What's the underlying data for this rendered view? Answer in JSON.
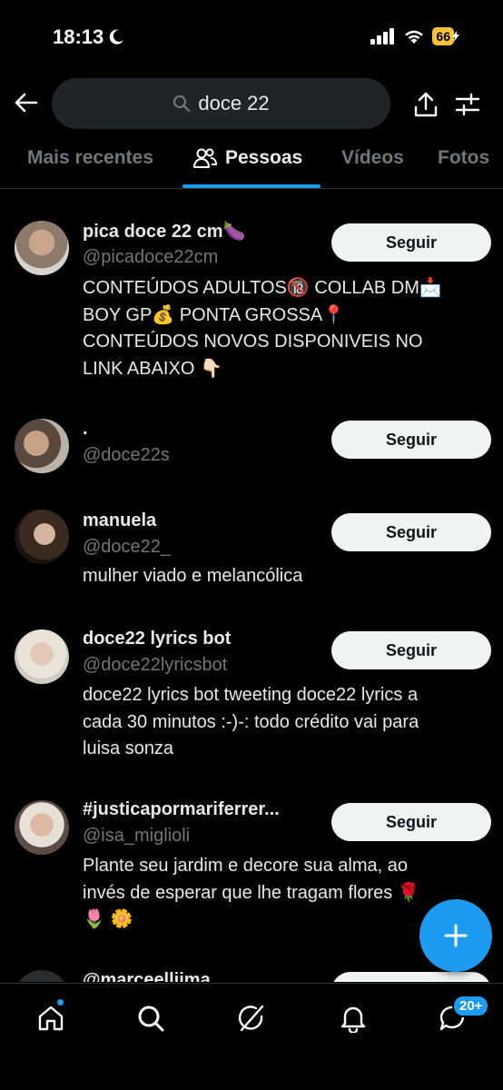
{
  "status_bar": {
    "time": "18:13",
    "moon_icon": "moon-icon",
    "signal_icon": "cellular-signal-icon",
    "wifi_icon": "wifi-icon",
    "battery": "66"
  },
  "search": {
    "query": "doce 22",
    "back_icon": "arrow-left-icon",
    "share_icon": "share-icon",
    "filter_icon": "filter-sliders-icon"
  },
  "tabs": [
    {
      "label": "Mais recentes",
      "active": false
    },
    {
      "label": "Pessoas",
      "active": true,
      "icon": "people-icon"
    },
    {
      "label": "Vídeos",
      "active": false
    },
    {
      "label": "Fotos",
      "active": false
    }
  ],
  "users": [
    {
      "name": "pica doce 22 cm🍆",
      "handle": "@picadoce22cm",
      "bio": [
        "CONTEÚDOS ADULTOS🔞 COLLAB DM📩",
        "BOY GP💰 PONTA GROSSA📍",
        "CONTEÚDOS NOVOS DISPONIVEIS NO",
        "LINK ABAIXO 👇🏻"
      ],
      "follow_label": "Seguir"
    },
    {
      "name": ".",
      "handle": "@doce22s",
      "bio": [],
      "follow_label": "Seguir"
    },
    {
      "name": "manuela",
      "handle": "@doce22_",
      "bio": [
        "mulher viado e melancólica"
      ],
      "follow_label": "Seguir"
    },
    {
      "name": "doce22 lyrics bot",
      "handle": "@doce22lyricsbot",
      "bio": [
        "doce22 lyrics bot tweeting doce22 lyrics a",
        "cada 30 minutos :-)-: todo crédito vai para",
        "luisa sonza"
      ],
      "follow_label": "Seguir"
    },
    {
      "name": "#justicapormariferrer...",
      "handle": "@isa_miglioli",
      "bio": [
        "Plante seu jardim e decore sua alma, ao",
        "invés de esperar que lhe tragam flores 🌹",
        "🌷 🌼"
      ],
      "follow_label": "Seguir"
    },
    {
      "name": "@marceelliima",
      "handle": "",
      "bio": [],
      "follow_label": ""
    }
  ],
  "fab": {
    "icon": "plus-icon"
  },
  "bottom_nav": {
    "home_icon": "home-icon",
    "search_icon": "search-icon",
    "grok_icon": "grok-icon",
    "notifications_icon": "bell-icon",
    "messages_icon": "chat-bubble-icon",
    "messages_badge": "20+"
  },
  "colors": {
    "background": "#000000",
    "accent": "#1d9bf0",
    "text": "#e7e9ea",
    "muted": "#71767b",
    "battery": "#f6c433"
  }
}
